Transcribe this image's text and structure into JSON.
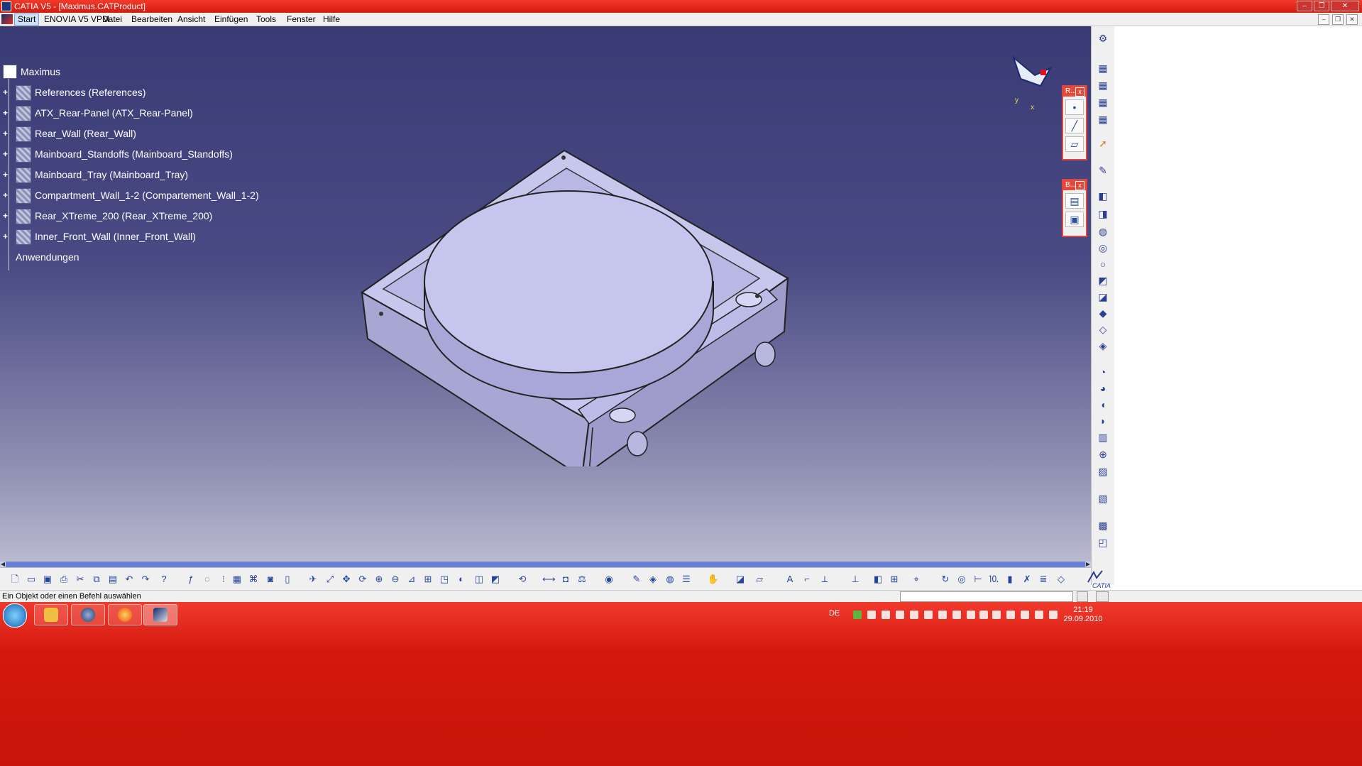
{
  "window": {
    "title": "CATIA V5 - [Maximus.CATProduct]",
    "buttons": [
      "–",
      "❐",
      "✕"
    ]
  },
  "menu": {
    "items": [
      "Start",
      "ENOVIA V5 VPM",
      "Datei",
      "Bearbeiten",
      "Ansicht",
      "Einfügen",
      "Tools",
      "Fenster",
      "Hilfe"
    ],
    "mdi_buttons": [
      "–",
      "❐",
      "✕"
    ]
  },
  "tree": {
    "root": "Maximus",
    "nodes": [
      "References (References)",
      "ATX_Rear-Panel (ATX_Rear-Panel)",
      "Rear_Wall (Rear_Wall)",
      "Mainboard_Standoffs (Mainboard_Standoffs)",
      "Mainboard_Tray (Mainboard_Tray)",
      "Compartment_Wall_1-2 (Compartement_Wall_1-2)",
      "Rear_XTreme_200 (Rear_XTreme_200)",
      "Inner_Front_Wall (Inner_Front_Wall)"
    ],
    "applications": "Anwendungen"
  },
  "compass": {
    "axis_y": "y",
    "axis_x": "x"
  },
  "floating_toolbars": [
    {
      "title": "R...",
      "close": "x",
      "icons": [
        "point-icon",
        "line-icon",
        "plane-icon"
      ]
    },
    {
      "title": "B...",
      "close": "x",
      "icons": [
        "body-icon",
        "cube-icon"
      ]
    }
  ],
  "status": {
    "message": "Ein Objekt oder einen Befehl auswählen",
    "command_input": ""
  },
  "taskbar": {
    "apps": [
      "explorer-icon",
      "itunes-icon",
      "firefox-icon",
      "catia-icon"
    ],
    "language": "DE",
    "time": "21:19",
    "date": "29.09.2010"
  },
  "brand": "CATIA"
}
